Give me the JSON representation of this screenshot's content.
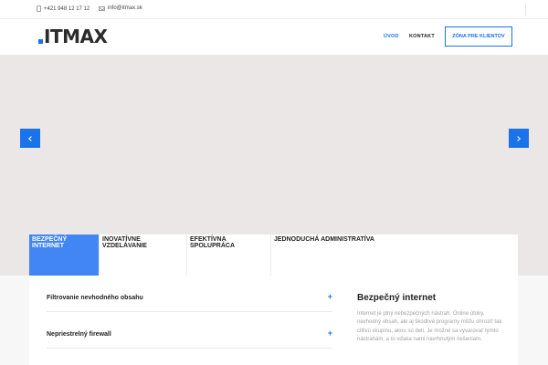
{
  "topbar": {
    "phone": "+421 948 12 17 12",
    "email": "info@itmax.sk"
  },
  "header": {
    "logo_text": "ITMAX",
    "nav": {
      "uvod": "ÚVOD",
      "kontakt": "KONTAKT"
    },
    "client_button": "ZÓNA PRE KLIENTOV"
  },
  "colors": {
    "accent": "#1a73e8",
    "tab_active": "#4285f4",
    "hero_bg": "#ebe7e6"
  },
  "tabs": [
    {
      "label": "BEZPEČNÝ INTERNET",
      "active": true
    },
    {
      "label": "INOVATÍVNE VZDELÁVANIE",
      "active": false
    },
    {
      "label": "EFEKTÍVNA SPOLUPRÁCA",
      "active": false
    },
    {
      "label": "JEDNODUCHÁ ADMINISTRATÍVA",
      "active": false
    }
  ],
  "accordion": [
    {
      "title": "Filtrovanie nevhodného obsahu",
      "icon": "+"
    },
    {
      "title": "Nepriestrelný firewall",
      "icon": "+"
    }
  ],
  "side": {
    "title": "Bezpečný internet",
    "text": "Internet je plný nebezpečných nástrah. Online útoky, nevhodný obsah, ale aj škodlivé programy môžu ohroziť tak citlivú skupinu, akou sú deti. Je možné sa vyvarovať týmto nástrahám, a to vďaka nami navrhnutým riešeniam."
  }
}
